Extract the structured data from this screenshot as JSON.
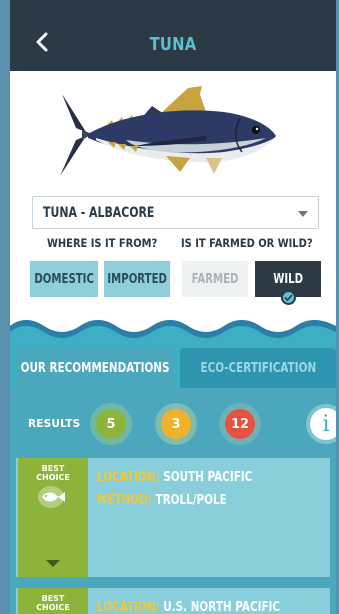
{
  "header": {
    "title": "TUNA",
    "back_icon": "chevron-left-icon"
  },
  "species_select": {
    "value": "TUNA - ALBACORE"
  },
  "questions": {
    "origin": "WHERE IS IT FROM?",
    "method": "IS IT FARMED OR WILD?"
  },
  "options": {
    "domestic": "DOMESTIC",
    "imported": "IMPORTED",
    "farmed": "FARMED",
    "wild": "WILD"
  },
  "tabs": {
    "recommendations": "OUR RECOMMENDATIONS",
    "eco_certification": "ECO-CERTIFICATION"
  },
  "results": {
    "label": "RESULTS",
    "best_choice_count": "5",
    "good_alternative_count": "3",
    "avoid_count": "12",
    "info_label": "i"
  },
  "cards": [
    {
      "badge": "BEST CHOICE",
      "location_key": "LOCATION:",
      "location": "SOUTH PACIFIC",
      "method_key": "METHOD:",
      "method": "TROLL/POLE"
    },
    {
      "badge": "BEST CHOICE",
      "location_key": "LOCATION:",
      "location": "U.S. NORTH PACIFIC"
    }
  ],
  "colors": {
    "header": "#2b3a45",
    "accent": "#5ec0cf",
    "water": "#3eaec4",
    "best_choice": "#8db33a",
    "good_alternative": "#f0b22a",
    "avoid": "#e6523e"
  }
}
